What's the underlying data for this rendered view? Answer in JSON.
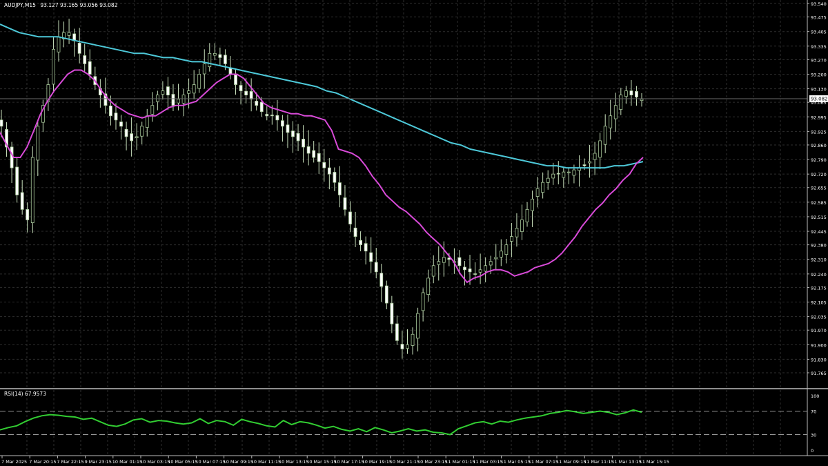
{
  "header": {
    "symbol_timeframe": "AUDJPY,M15",
    "ohlc": "93.127 93.165 93.056 93.082"
  },
  "price_axis": {
    "ticks": [
      "93.540",
      "93.475",
      "93.405",
      "93.335",
      "93.270",
      "93.200",
      "93.130",
      "93.065",
      "92.995",
      "92.925",
      "92.860",
      "92.790",
      "92.720",
      "92.655",
      "92.585",
      "92.515",
      "92.445",
      "92.380",
      "92.310",
      "92.240",
      "92.175",
      "92.105",
      "92.035",
      "91.970",
      "91.900",
      "91.830",
      "91.765"
    ],
    "current_price": "93.082"
  },
  "indicator": {
    "label": "RSI(14) 67.9573",
    "levels": [
      "100",
      "70",
      "30",
      "0"
    ]
  },
  "time_axis": {
    "labels": [
      "7 Mar 2025",
      "7 Mar 20:15",
      "7 Mar 22:15",
      "9 Mar 23:15",
      "10 Mar 01:15",
      "10 Mar 03:15",
      "10 Mar 05:15",
      "10 Mar 07:15",
      "10 Mar 09:15",
      "10 Mar 11:15",
      "10 Mar 13:15",
      "10 Mar 15:15",
      "10 Mar 17:15",
      "10 Mar 19:15",
      "10 Mar 21:15",
      "10 Mar 23:15",
      "11 Mar 01:15",
      "11 Mar 03:15",
      "11 Mar 05:15",
      "11 Mar 07:15",
      "11 Mar 09:15",
      "11 Mar 11:15",
      "11 Mar 13:15",
      "11 Mar 15:15"
    ]
  },
  "colors": {
    "background": "#000000",
    "grid": "#2e2e2e",
    "candle_bull_fill": "#000000",
    "candle_bull_border": "#a8c99a",
    "candle_bear_fill": "#ffffff",
    "candle_wick": "#c8e0bc",
    "ma_fast": "#d84ad8",
    "ma_slow": "#4dc8d8",
    "rsi_line": "#32cd32",
    "text": "#ffffff",
    "level_line": "#9a9a9a"
  },
  "chart_data": {
    "type": "line",
    "ylim": [
      91.765,
      93.54
    ],
    "x": [
      0,
      5,
      10,
      15,
      20,
      25,
      30,
      35,
      40,
      45,
      50,
      55,
      60,
      65,
      70,
      75,
      80,
      85,
      90,
      95,
      100,
      105,
      110,
      115,
      120,
      125,
      130,
      135,
      140,
      145,
      150,
      155,
      160,
      165,
      170,
      175,
      180,
      185,
      190,
      195,
      200,
      205,
      210,
      215,
      220,
      225,
      230,
      235,
      240,
      245,
      250,
      255,
      260,
      265,
      270,
      275,
      280,
      285,
      290,
      295,
      300,
      305,
      310,
      315,
      320,
      325,
      330,
      335,
      340,
      345,
      350,
      355,
      360,
      365,
      370,
      375,
      380,
      385,
      390,
      395,
      400,
      405,
      410,
      415,
      420,
      425,
      430,
      435,
      440,
      445,
      450,
      455,
      460,
      465,
      470,
      475,
      480,
      485,
      490,
      495,
      500,
      505,
      510,
      515,
      520,
      525,
      530,
      535,
      540,
      545,
      550,
      555,
      560,
      565,
      570,
      575,
      580,
      585,
      590,
      595,
      600,
      605,
      610,
      615,
      620,
      625,
      630,
      635,
      640,
      645,
      650,
      655,
      660,
      665,
      670,
      675,
      680,
      685,
      690,
      695,
      700,
      705,
      710,
      715,
      720,
      725,
      730,
      735,
      740,
      745,
      750,
      755,
      760,
      765,
      770,
      775,
      780,
      785,
      790,
      795,
      800,
      805,
      810,
      815,
      820,
      825,
      830,
      835,
      840,
      845,
      850,
      855,
      860,
      865,
      870,
      875,
      880,
      885,
      890,
      895,
      900,
      905,
      910,
      915,
      920,
      925,
      930
    ],
    "series": [
      {
        "values": [
          92.95,
          92.85,
          92.75,
          92.62,
          92.55,
          92.5,
          92.8,
          92.95,
          93.05,
          93.15,
          93.32,
          93.38,
          93.4,
          93.4,
          93.36,
          93.3,
          93.25,
          93.2,
          93.15,
          93.1,
          93.05,
          93.0,
          92.98,
          92.95,
          92.9,
          92.88,
          92.9,
          92.95,
          93.0,
          93.05,
          93.1,
          93.12,
          93.1,
          93.05,
          93.08,
          93.1,
          93.12,
          93.15,
          93.2,
          93.25,
          93.3,
          93.3,
          93.28,
          93.25,
          93.2,
          93.15,
          93.12,
          93.1,
          93.08,
          93.05,
          93.02,
          93.0,
          93.0,
          92.98,
          92.95,
          92.92,
          92.9,
          92.88,
          92.85,
          92.82,
          92.8,
          92.78,
          92.75,
          92.72,
          92.68,
          92.62,
          92.55,
          92.48,
          92.42,
          92.38,
          92.35,
          92.3,
          92.25,
          92.18,
          92.1,
          92.0,
          91.92,
          91.88,
          91.9,
          91.95,
          92.05,
          92.15,
          92.22,
          92.28,
          92.3,
          92.32,
          92.31,
          92.3,
          92.28,
          92.26,
          92.25,
          92.24,
          92.26,
          92.28,
          92.3,
          92.32,
          92.35,
          92.38,
          92.42,
          92.46,
          92.5,
          92.55,
          92.6,
          92.65,
          92.68,
          92.7,
          92.72,
          92.72,
          92.73,
          92.73,
          92.74,
          92.75,
          92.76,
          92.78,
          92.82,
          92.88,
          92.95,
          93.0,
          93.05,
          93.1,
          93.12,
          93.1,
          93.09,
          93.08
        ],
        "ma_fast": [
          92.92,
          92.86,
          92.8,
          92.8,
          92.85,
          92.93,
          93.01,
          93.07,
          93.12,
          93.16,
          93.2,
          93.22,
          93.22,
          93.2,
          93.17,
          93.12,
          93.08,
          93.05,
          93.03,
          93.01,
          93.0,
          92.99,
          93.0,
          93.0,
          93.02,
          93.04,
          93.05,
          93.05,
          93.06,
          93.07,
          93.1,
          93.13,
          93.16,
          93.18,
          93.2,
          93.2,
          93.18,
          93.14,
          93.1,
          93.06,
          93.04,
          93.03,
          93.02,
          93.01,
          93.01,
          93.0,
          93.0,
          92.99,
          92.98,
          92.93,
          92.84,
          92.83,
          92.82,
          92.8,
          92.76,
          92.71,
          92.67,
          92.62,
          92.59,
          92.56,
          92.54,
          92.51,
          92.48,
          92.44,
          92.41,
          92.38,
          92.34,
          92.3,
          92.24,
          92.2,
          92.22,
          92.23,
          92.25,
          92.26,
          92.26,
          92.25,
          92.23,
          92.24,
          92.25,
          92.27,
          92.28,
          92.29,
          92.31,
          92.34,
          92.38,
          92.42,
          92.47,
          92.51,
          92.55,
          92.58,
          92.62,
          92.65,
          92.69,
          92.72,
          92.77,
          92.8
        ]
      },
      {
        "ma_slow": [
          93.44,
          93.42,
          93.4,
          93.39,
          93.38,
          93.38,
          93.38,
          93.37,
          93.36,
          93.35,
          93.34,
          93.33,
          93.32,
          93.31,
          93.3,
          93.3,
          93.29,
          93.28,
          93.28,
          93.27,
          93.26,
          93.26,
          93.25,
          93.24,
          93.23,
          93.22,
          93.21,
          93.2,
          93.19,
          93.18,
          93.17,
          93.16,
          93.15,
          93.14,
          93.12,
          93.11,
          93.09,
          93.07,
          93.05,
          93.03,
          93.01,
          92.99,
          92.97,
          92.95,
          92.93,
          92.91,
          92.89,
          92.87,
          92.86,
          92.84,
          92.83,
          92.82,
          92.81,
          92.8,
          92.79,
          92.78,
          92.77,
          92.76,
          92.76,
          92.75,
          92.75,
          92.75,
          92.75,
          92.75,
          92.76,
          92.76,
          92.77,
          92.78
        ]
      }
    ],
    "rsi": [
      38,
      42,
      45,
      52,
      58,
      62,
      64,
      63,
      61,
      60,
      56,
      58,
      52,
      46,
      44,
      48,
      55,
      57,
      51,
      54,
      53,
      50,
      48,
      50,
      57,
      49,
      54,
      52,
      46,
      56,
      52,
      49,
      45,
      43,
      54,
      47,
      52,
      50,
      46,
      41,
      44,
      39,
      36,
      40,
      35,
      42,
      38,
      33,
      36,
      40,
      36,
      38,
      34,
      33,
      30,
      40,
      45,
      50,
      52,
      48,
      53,
      51,
      55,
      58,
      60,
      62,
      66,
      68,
      71,
      69,
      66,
      68,
      70,
      68,
      64,
      67,
      72,
      68
    ]
  }
}
